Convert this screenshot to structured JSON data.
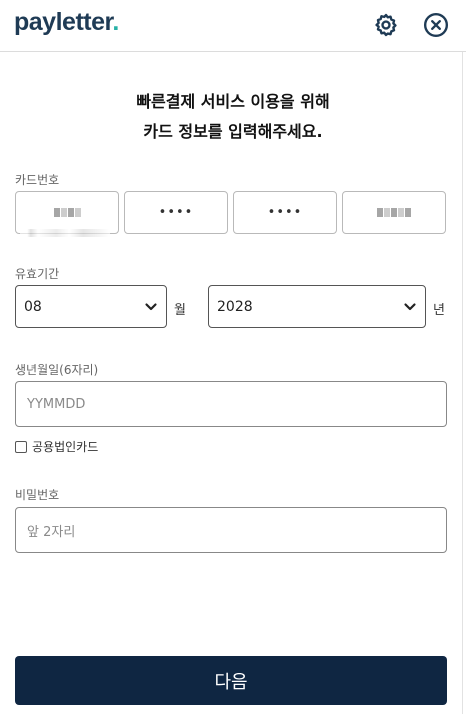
{
  "header": {
    "logo_pay": "pay",
    "logo_letter": "letter",
    "logo_dot": ".",
    "settings_icon": "gear-icon",
    "close_icon": "close-circle-icon"
  },
  "headline": {
    "line1": "빠른결제 서비스 이용을 위해",
    "line2": "카드 정보를 입력해주세요."
  },
  "card_number": {
    "label": "카드번호",
    "fields": [
      "",
      "••••",
      "••••",
      ""
    ]
  },
  "expiry": {
    "label": "유효기간",
    "month_value": "08",
    "month_unit": "월",
    "year_value": "2028",
    "year_unit": "년"
  },
  "birth": {
    "label": "생년월일(6자리)",
    "placeholder": "YYMMDD"
  },
  "corporate": {
    "label": "공용법인카드",
    "checked": false
  },
  "password": {
    "label": "비밀번호",
    "placeholder": "앞 2자리"
  },
  "next_button": {
    "label": "다음"
  },
  "colors": {
    "brand_dark": "#1f3b55",
    "brand_accent": "#27b1a6",
    "button_bg": "#0f2642"
  }
}
